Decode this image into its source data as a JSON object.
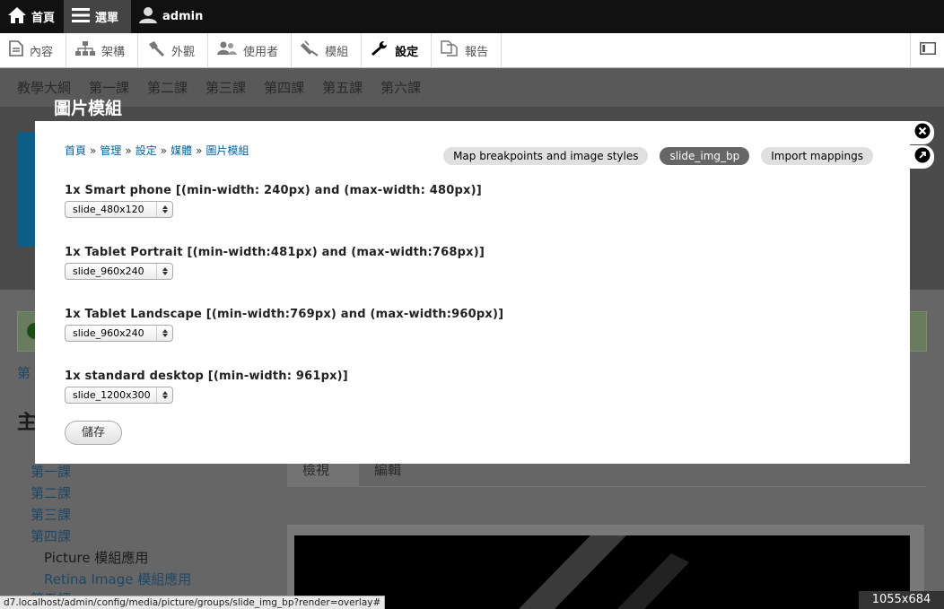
{
  "toolbar": {
    "home_label": "首頁",
    "menu_label": "選單",
    "user_label": "admin"
  },
  "tray": {
    "items": [
      {
        "label": "內容",
        "icon": "content-icon"
      },
      {
        "label": "架構",
        "icon": "structure-icon"
      },
      {
        "label": "外觀",
        "icon": "appearance-icon"
      },
      {
        "label": "使用者",
        "icon": "people-icon"
      },
      {
        "label": "模組",
        "icon": "modules-icon"
      },
      {
        "label": "設定",
        "icon": "configuration-icon"
      },
      {
        "label": "報告",
        "icon": "reports-icon"
      }
    ]
  },
  "background": {
    "nav": [
      "教學大綱",
      "第一課",
      "第二課",
      "第三課",
      "第四課",
      "第五課",
      "第六課"
    ],
    "side_items": [
      "第一課",
      "第二課",
      "第三課",
      "第四課"
    ],
    "sub_items": [
      "Picture 模組應用",
      "Retina Image 模組應用"
    ],
    "tabs": [
      "檢視",
      "編輯"
    ],
    "partial_first": "第",
    "partial_heading": "主",
    "partial_last": "第五課"
  },
  "overlay": {
    "title": "圖片模組"
  },
  "modal": {
    "breadcrumb": [
      "首頁",
      "管理",
      "設定",
      "媒體",
      "圖片模組"
    ],
    "breadcrumb_sep": "»",
    "tabs": [
      {
        "label": "Map breakpoints and image styles",
        "active": false
      },
      {
        "label": "slide_img_bp",
        "active": true
      },
      {
        "label": "Import mappings",
        "active": false
      }
    ],
    "fields": [
      {
        "label": "1x Smart phone [(min-width: 240px) and (max-width: 480px)]",
        "value": "slide_480x120"
      },
      {
        "label": "1x Tablet Portrait [(min-width:481px) and (max-width:768px)]",
        "value": "slide_960x240"
      },
      {
        "label": "1x Tablet Landscape [(min-width:769px) and (max-width:960px)]",
        "value": "slide_960x240"
      },
      {
        "label": "1x standard desktop [(min-width: 961px)]",
        "value": "slide_1200x300"
      }
    ],
    "save_label": "儲存"
  },
  "status": {
    "url": "d7.localhost/admin/config/media/picture/groups/slide_img_bp?render=overlay#",
    "dimensions": "1055x684"
  }
}
